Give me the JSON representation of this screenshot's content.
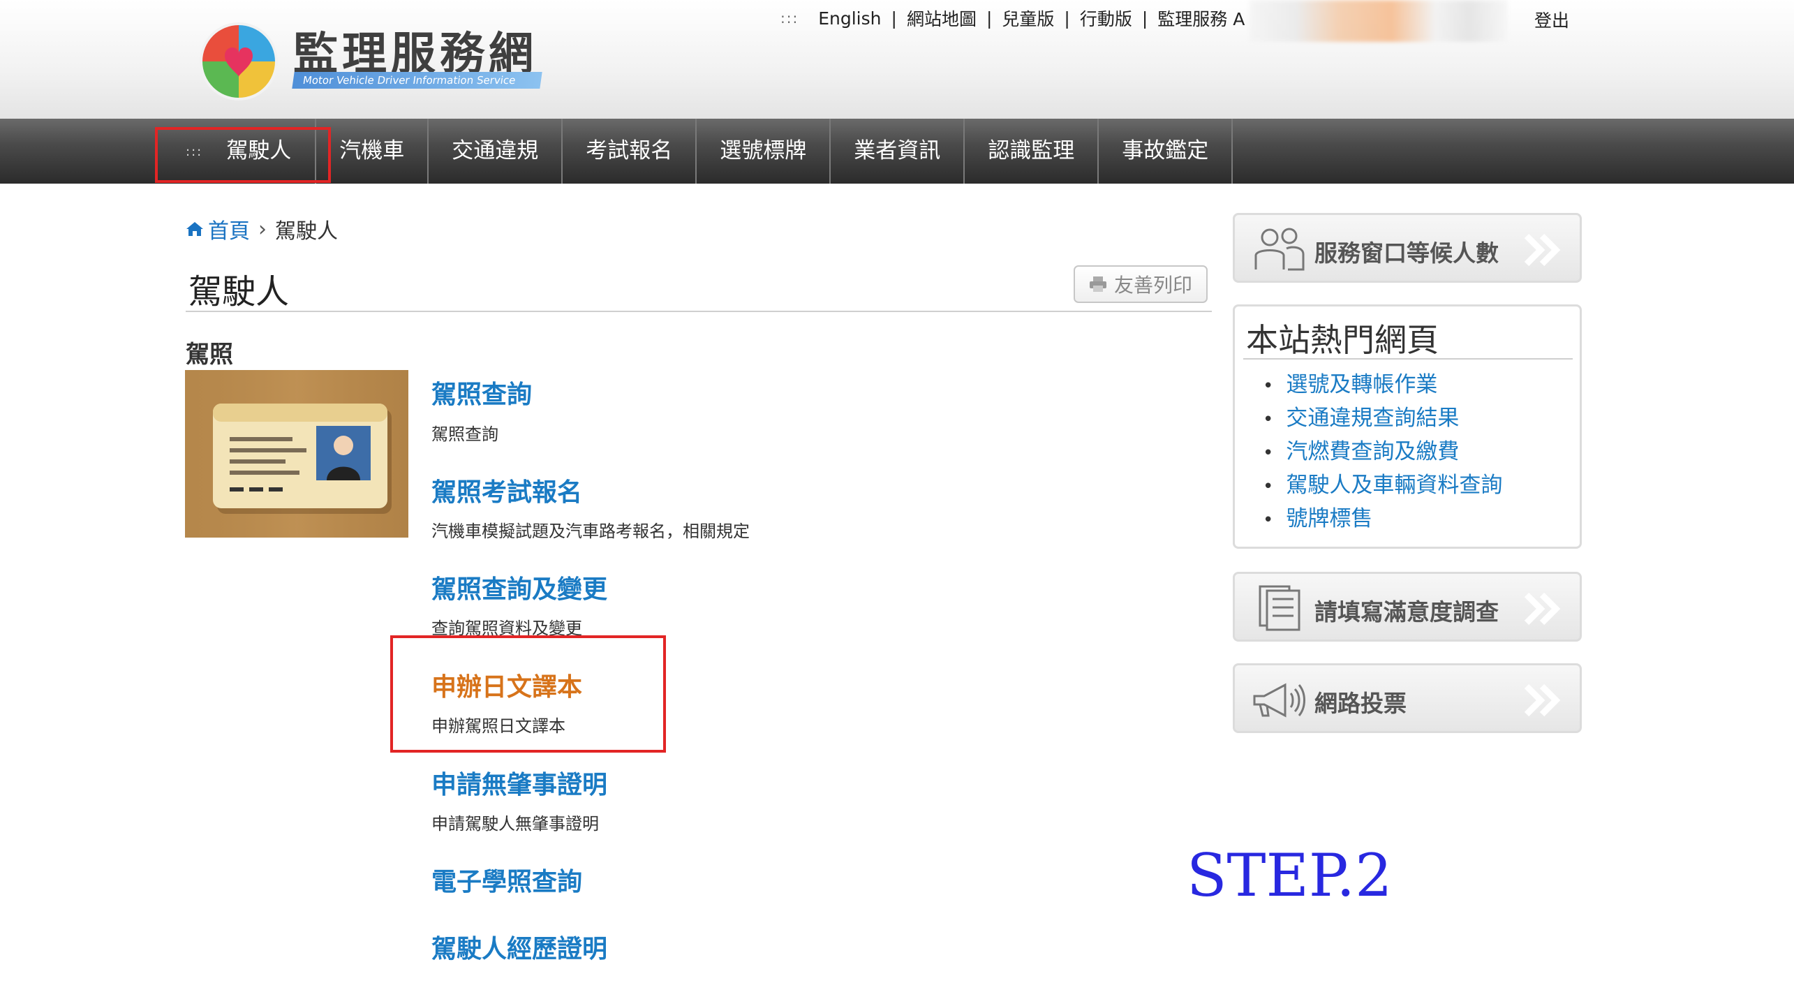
{
  "header": {
    "logo_text": "監理服務網",
    "logo_subtitle": "Motor Vehicle Driver Information Service",
    "top_dots": ":::",
    "top_links": [
      "English",
      "網站地圖",
      "兒童版",
      "行動版",
      "監理服務 A"
    ],
    "separator": "|",
    "logout": "登出"
  },
  "nav": {
    "dots": ":::",
    "items": [
      "駕駛人",
      "汽機車",
      "交通違規",
      "考試報名",
      "選號標牌",
      "業者資訊",
      "認識監理",
      "事故鑑定"
    ]
  },
  "breadcrumb": {
    "home": "首頁",
    "arrow": "›",
    "current": "駕駛人"
  },
  "page": {
    "title": "駕駛人",
    "print_label": "友善列印"
  },
  "section": {
    "heading": "駕照",
    "entries": [
      {
        "title": "駕照查詢",
        "desc": "駕照查詢"
      },
      {
        "title": "駕照考試報名",
        "desc": "汽機車模擬試題及汽車路考報名，相關規定"
      },
      {
        "title": "駕照查詢及變更",
        "desc": "查詢駕照資料及變更"
      },
      {
        "title": "申辦日文譯本",
        "desc": "申辦駕照日文譯本"
      },
      {
        "title": "申請無肇事證明",
        "desc": "申請駕駛人無肇事證明"
      },
      {
        "title": "電子學照查詢",
        "desc": ""
      },
      {
        "title": "駕駛人經歷證明",
        "desc": ""
      }
    ]
  },
  "sidebar": {
    "wait_button": "服務窗口等候人數",
    "hot_title": "本站熱門網頁",
    "hot_links": [
      "選號及轉帳作業",
      "交通違規查詢結果",
      "汽燃費查詢及繳費",
      "駕駛人及車輛資料查詢",
      "號牌標售"
    ],
    "survey_button": "請填寫滿意度調查",
    "vote_button": "網路投票"
  },
  "annotation": {
    "step": "STEP.2"
  },
  "colors": {
    "link": "#1a7bc4",
    "active_link": "#d7731a",
    "highlight": "#e22525",
    "step": "#2828e0"
  }
}
